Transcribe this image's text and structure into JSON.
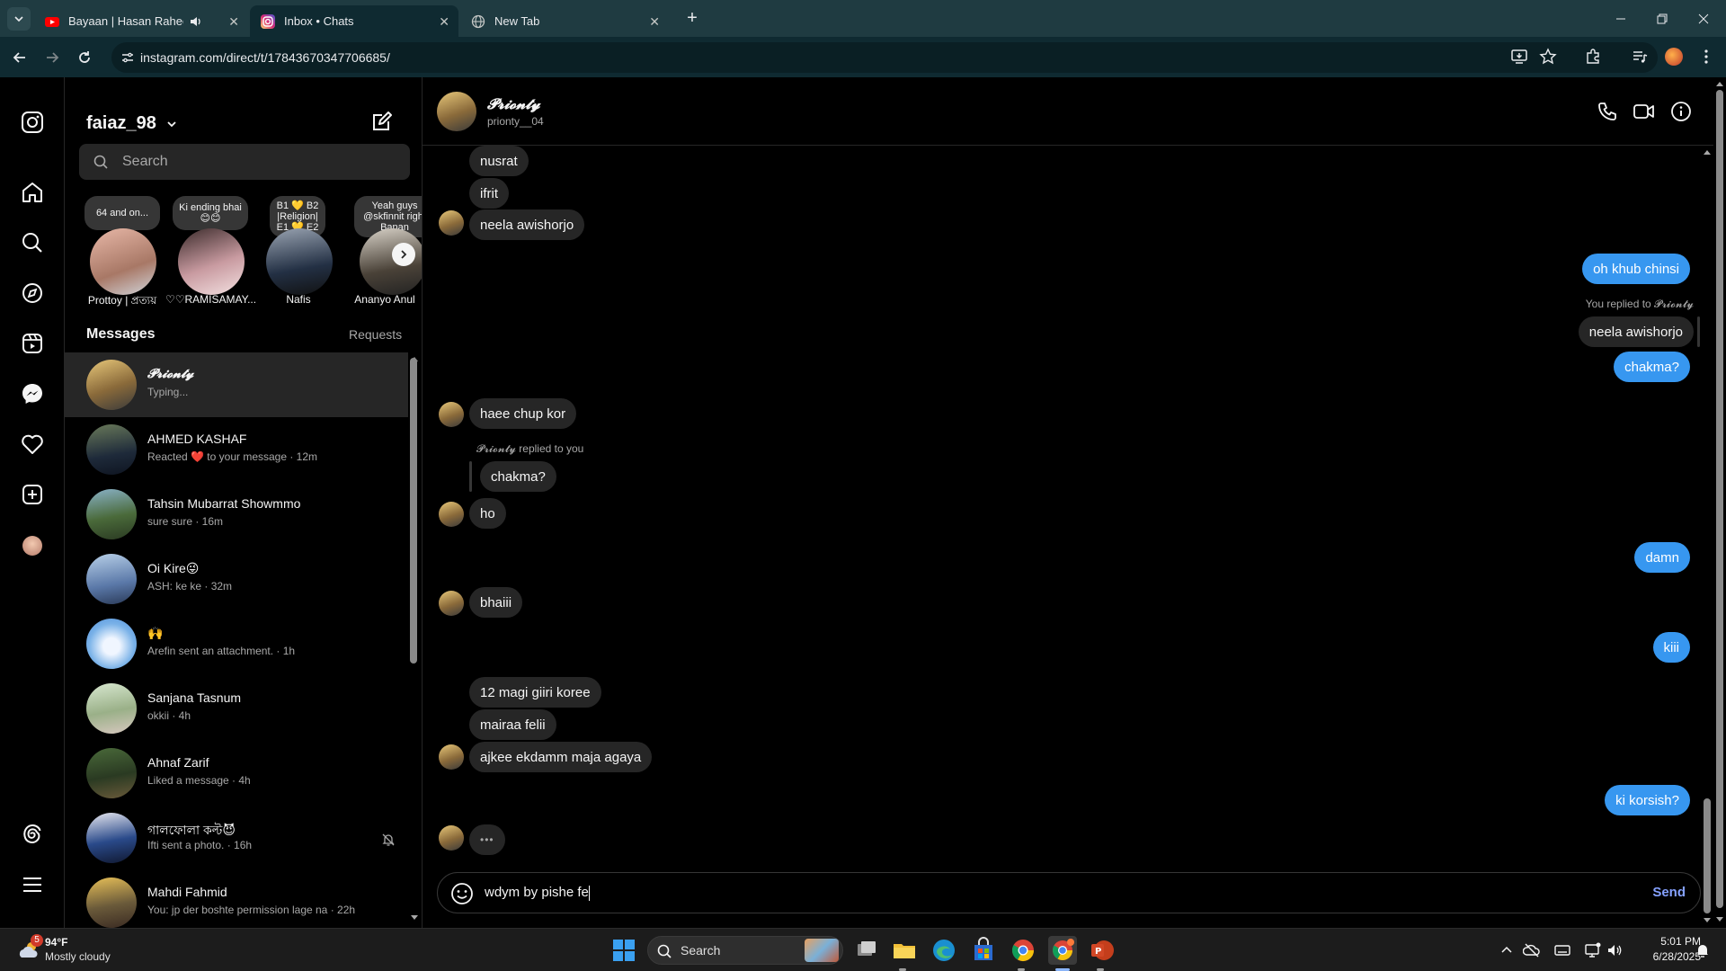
{
  "browser": {
    "tabs": [
      {
        "title": "Bayaan | Hasan Raheem | Ro",
        "active": false
      },
      {
        "title": "Inbox • Chats",
        "active": true
      },
      {
        "title": "New Tab",
        "active": false
      }
    ],
    "url": "instagram.com/direct/t/17843670347706685/"
  },
  "inbox": {
    "username": "faiaz_98",
    "search_placeholder": "Search",
    "messages_label": "Messages",
    "requests_label": "Requests",
    "stories": [
      {
        "note": "64 and on...",
        "name": "Prottoy | প্রত্যয়"
      },
      {
        "note": "Ki ending bhai 😊😊",
        "name": "♡♡RAMISAMAY..."
      },
      {
        "note": "B1 💛 B2 |Religion| E1 💛 E2",
        "name": "Nafis"
      },
      {
        "note": "Yeah guys @skfinnit right Banan",
        "name": "Ananyo Anul"
      }
    ],
    "conversations": [
      {
        "name": "𝓟𝓻𝓲𝓸𝓷𝓽𝔂",
        "preview": "Typing..."
      },
      {
        "name": "AHMED KASHAF",
        "preview": "Reacted ❤️ to your message · 12m"
      },
      {
        "name": "Tahsin Mubarrat Showmmo",
        "preview": "sure sure · 16m"
      },
      {
        "name": "Oi Kire😜",
        "preview": "ASH: ke ke · 32m"
      },
      {
        "name": "🙌",
        "preview": "Arefin sent an attachment. · 1h"
      },
      {
        "name": "Sanjana Tasnum",
        "preview": "okkii · 4h"
      },
      {
        "name": "Ahnaf Zarif",
        "preview": "Liked a message · 4h"
      },
      {
        "name": "গালফোলা কল্ট😈",
        "preview": "Ifti sent a photo. · 16h"
      },
      {
        "name": "Mahdi Fahmid",
        "preview": "You: jp der boshte permission lage na · 22h"
      }
    ]
  },
  "chat": {
    "name": "𝓟𝓻𝓲𝓸𝓷𝓽𝔂",
    "handle": "prionty__04",
    "messages": {
      "m1": "nusrat",
      "m2": "ifrit",
      "m3": "neela awishorjo",
      "m4": "oh khub chinsi",
      "reply_meta": "You replied to 𝓟𝓻𝓲𝓸𝓷𝓽𝔂",
      "m5_quoted": "neela awishorjo",
      "m6": "chakma?",
      "m7": "haee chup kor",
      "reply_meta2": "𝓟𝓻𝓲𝓸𝓷𝓽𝔂 replied to you",
      "m8_quoted": "chakma?",
      "m9": "ho",
      "m10": "damn",
      "m11": "bhaiii",
      "m12": "kiii",
      "m13": "12 magi  giiri koree",
      "m14": "mairaa felii",
      "m15": "ajkee ekdamm maja agaya",
      "m16": "ki korsish?",
      "typing": "•••"
    },
    "input_value": "wdym by pishe fe",
    "send_label": "Send"
  },
  "taskbar": {
    "weather_temp": "94°F",
    "weather_desc": "Mostly cloudy",
    "weather_badge": "5",
    "search_label": "Search",
    "time": "5:01 PM",
    "date": "6/28/2025"
  },
  "colors": {
    "accent": "#3797f0",
    "bubble_in": "#262626",
    "bg": "#000000"
  }
}
